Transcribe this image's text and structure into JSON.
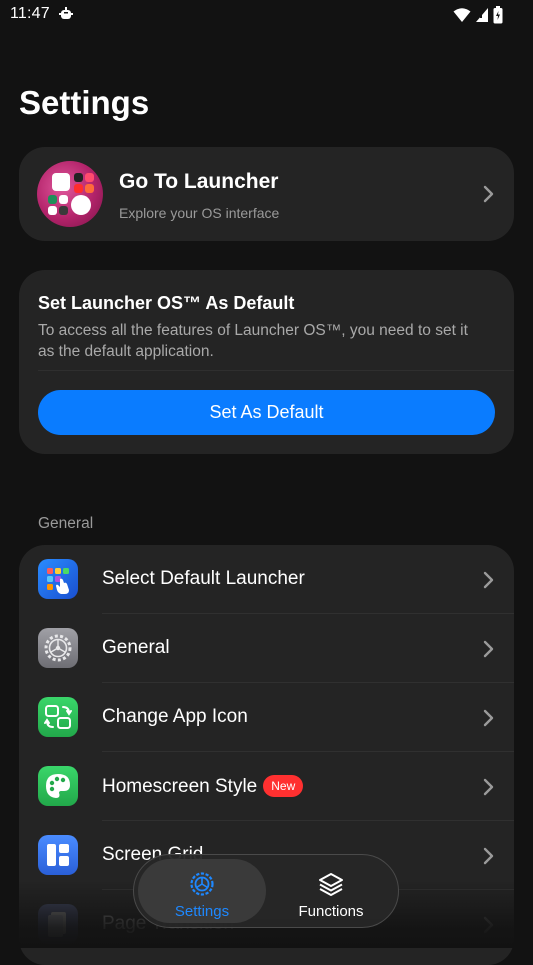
{
  "status_bar": {
    "time": "11:47",
    "icons": [
      "debug-notification-icon",
      "wifi-icon",
      "signal-icon",
      "battery-icon"
    ]
  },
  "page": {
    "title": "Settings"
  },
  "launcher_card": {
    "title": "Go To Launcher",
    "subtitle": "Explore your OS interface"
  },
  "default_card": {
    "title": "Set Launcher OS™ As Default",
    "description": "To access all the features of Launcher OS™, you need to set it as the default application.",
    "button_label": "Set As Default"
  },
  "general_section": {
    "label": "General",
    "items": [
      {
        "label": "Select Default Launcher",
        "icon": "default-launcher-icon",
        "color": "#1f6fe8"
      },
      {
        "label": "General",
        "icon": "gear-icon",
        "color": "#8e8e93"
      },
      {
        "label": "Change App Icon",
        "icon": "change-app-icon",
        "color": "#2fc15a"
      },
      {
        "label": "Homescreen Style",
        "icon": "palette-icon",
        "color": "#2fc15a",
        "badge": "New"
      },
      {
        "label": "Screen Grid",
        "icon": "grid-icon",
        "color": "#3d7cf0"
      },
      {
        "label": "Page Transition",
        "icon": "page-transition-icon",
        "color": "#5a6aa0"
      }
    ]
  },
  "bottom_nav": {
    "tabs": [
      {
        "label": "Settings",
        "icon": "settings-gear-icon",
        "active": true
      },
      {
        "label": "Functions",
        "icon": "layers-icon",
        "active": false
      }
    ]
  },
  "colors": {
    "background": "#121212",
    "card": "#242424",
    "accent_blue": "#0a7cff",
    "badge_red": "#ff3030"
  }
}
